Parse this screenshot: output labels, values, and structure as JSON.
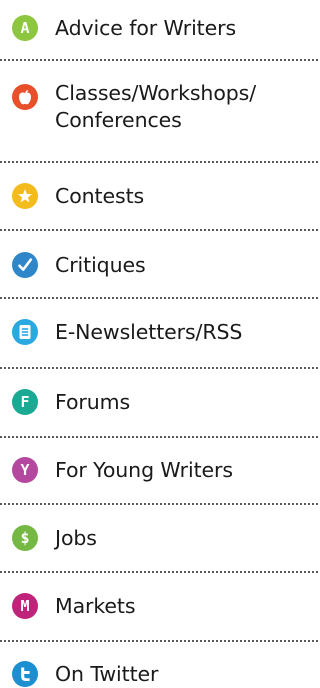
{
  "menu": {
    "items": [
      {
        "label": "Advice for Writers",
        "icon": "letter-a-icon",
        "color": "#8dc63f"
      },
      {
        "label": "Classes/Workshops/\nConferences",
        "icon": "apple-icon",
        "color": "#e8502b"
      },
      {
        "label": "Contests",
        "icon": "star-icon",
        "color": "#f3bb1c"
      },
      {
        "label": "Critiques",
        "icon": "checkmark-icon",
        "color": "#2f86c9"
      },
      {
        "label": "E-Newsletters/RSS",
        "icon": "newsletter-icon",
        "color": "#29a9e0"
      },
      {
        "label": "Forums",
        "icon": "letter-f-icon",
        "color": "#1aaa93"
      },
      {
        "label": "For Young Writers",
        "icon": "letter-y-icon",
        "color": "#b4489e"
      },
      {
        "label": "Jobs",
        "icon": "dollar-icon",
        "color": "#75b843"
      },
      {
        "label": "Markets",
        "icon": "letter-m-icon",
        "color": "#c0247a"
      },
      {
        "label": "On Twitter",
        "icon": "twitter-icon",
        "color": "#1c8fd0"
      }
    ],
    "icon_glyphs": {
      "a": "A",
      "f": "F",
      "y": "Y",
      "dollar": "$",
      "m": "M"
    }
  }
}
